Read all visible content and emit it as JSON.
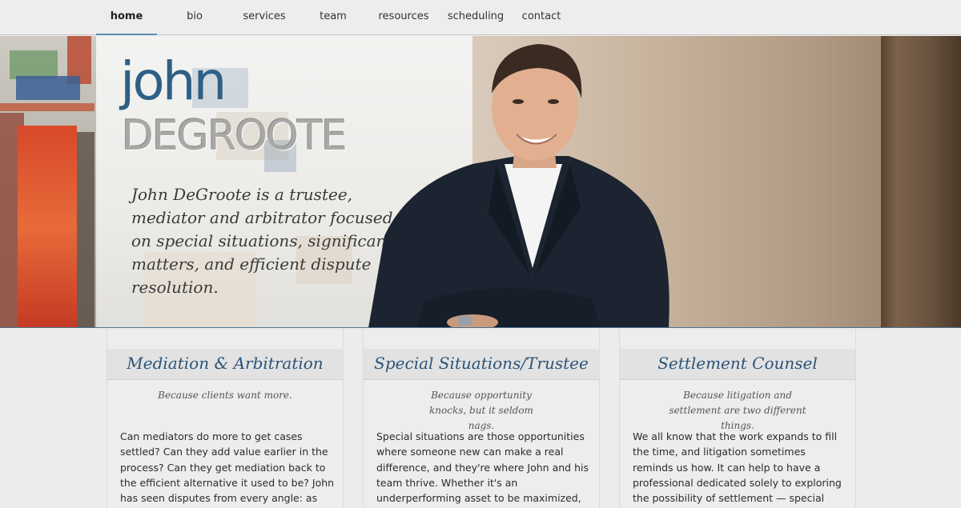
{
  "nav": {
    "items": [
      "home",
      "bio",
      "services",
      "team",
      "resources",
      "scheduling",
      "contact"
    ],
    "active": "home"
  },
  "hero": {
    "logo_first": "john",
    "logo_last": "DEGROOTE",
    "tagline": "John DeGroote is a trustee, mediator and arbitrator focused on special situations, significant matters, and efficient dispute resolution."
  },
  "columns": [
    {
      "title": "Mediation & Arbitration",
      "subtitle": "Because clients want more.",
      "body": "Can mediators do more to get cases settled? Can they add value earlier in the process? Can they get mediation back to the efficient alternative it used to be? John has seen disputes from every angle: as the client, as"
    },
    {
      "title": "Special Situations/Trustee",
      "subtitle": "Because opportunity knocks, but it seldom nags.",
      "body": "Special situations are those opportunities where someone new can make a real difference, and they're where John and his team thrive. Whether it's an underperforming asset to be maximized, gridlock that has to"
    },
    {
      "title": "Settlement Counsel",
      "subtitle": "Because litigation and settlement are two different things.",
      "body": "We all know that the work expands to fill the time, and litigation sometimes reminds us how. It can help to have a professional dedicated solely to exploring the possibility of settlement — special settlement counsel —"
    }
  ],
  "colors": {
    "brand_blue": "#2f5f85",
    "heading_blue": "#2c5478",
    "nav_accent": "#5b8fae"
  }
}
